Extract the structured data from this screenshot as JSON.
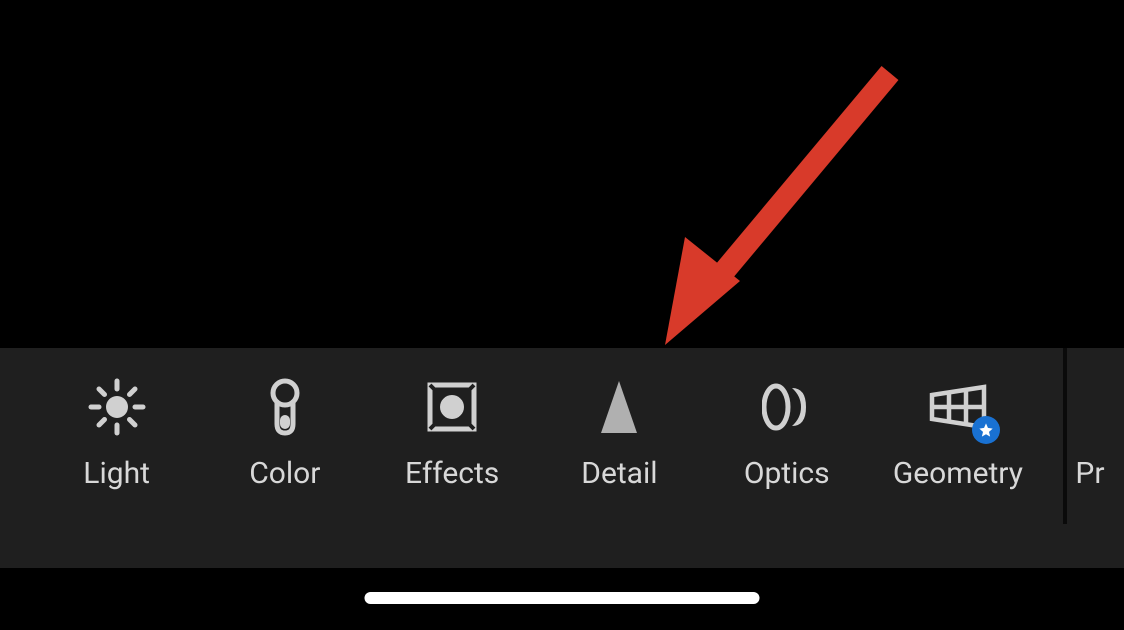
{
  "toolbar": {
    "items": [
      {
        "label": "Light"
      },
      {
        "label": "Color"
      },
      {
        "label": "Effects"
      },
      {
        "label": "Detail"
      },
      {
        "label": "Optics"
      },
      {
        "label": "Geometry"
      },
      {
        "label": "Pr"
      }
    ]
  },
  "annotation": {
    "arrow_color": "#d83a2a",
    "points_to": "detail-button"
  }
}
